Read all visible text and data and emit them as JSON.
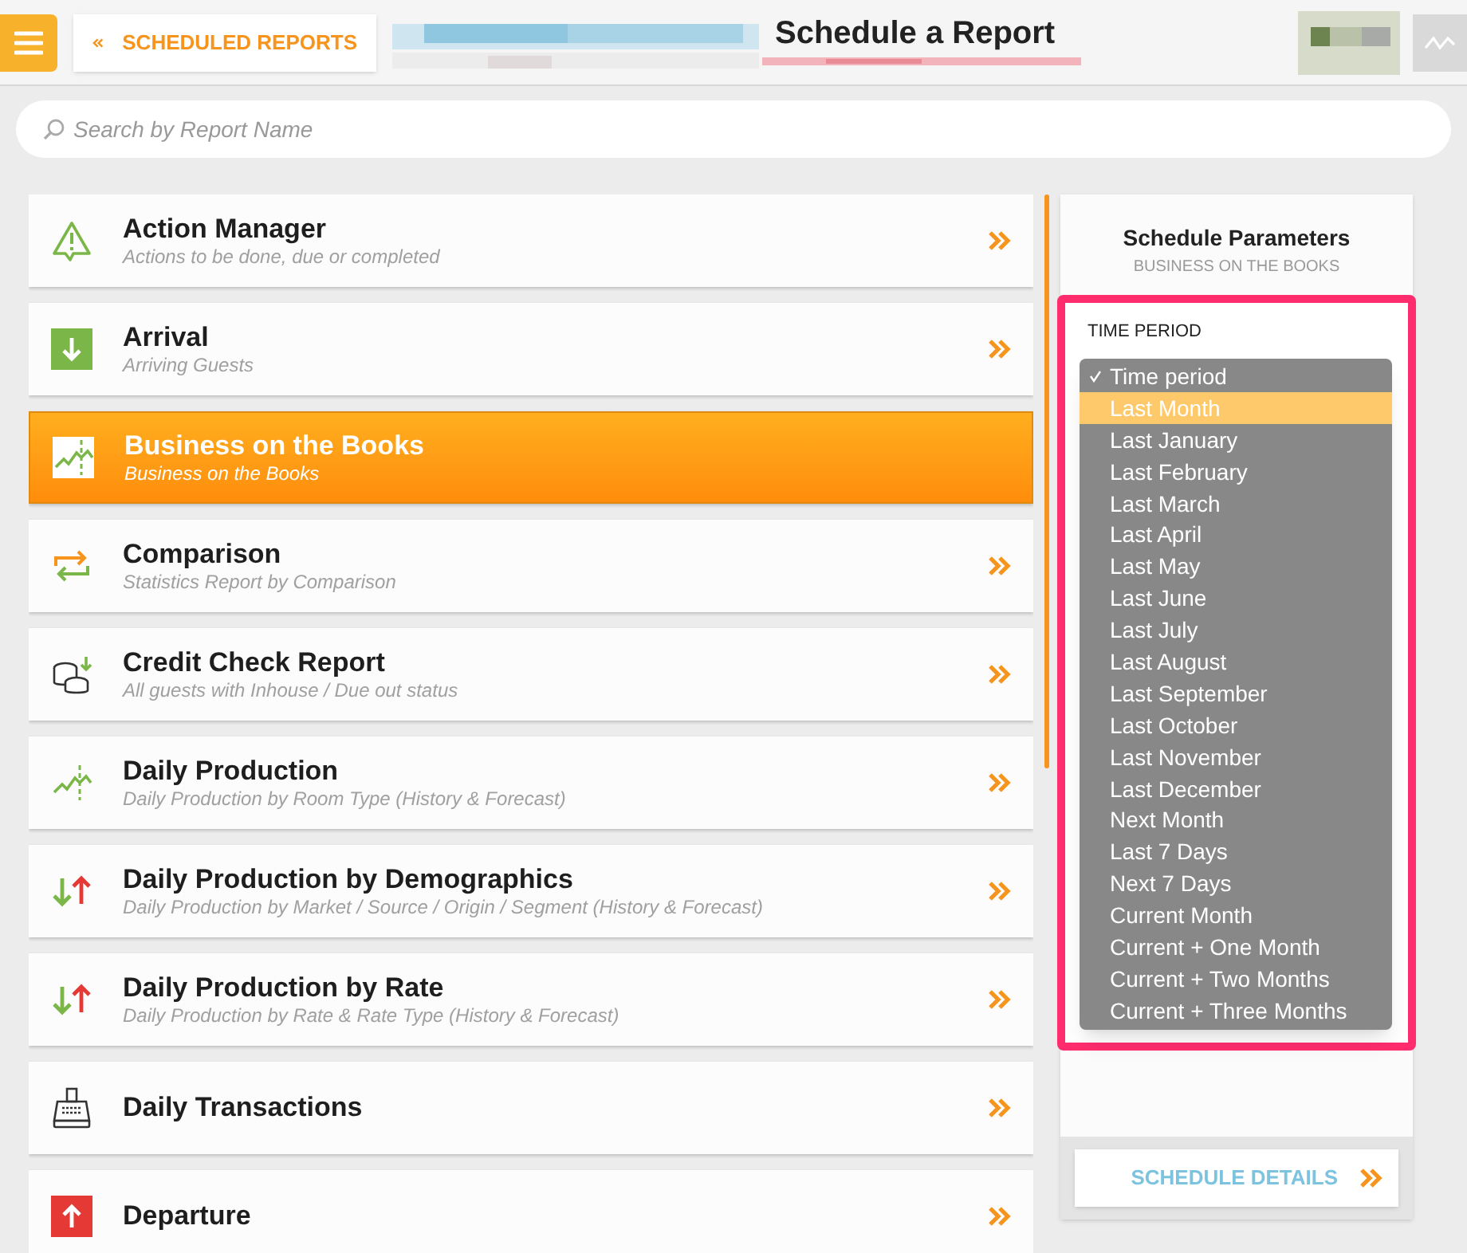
{
  "header": {
    "back_label": "SCHEDULED REPORTS",
    "title": "Schedule a Report"
  },
  "search": {
    "placeholder": "Search by Report Name"
  },
  "reports": [
    {
      "kind": "alert",
      "title": "Action Manager",
      "subtitle": "Actions to be done, due or completed",
      "selected": false
    },
    {
      "kind": "arrival",
      "title": "Arrival",
      "subtitle": "Arriving Guests",
      "selected": false
    },
    {
      "kind": "chart",
      "title": "Business on the Books",
      "subtitle": "Business on the Books",
      "selected": true
    },
    {
      "kind": "compare",
      "title": "Comparison",
      "subtitle": "Statistics Report by Comparison",
      "selected": false
    },
    {
      "kind": "coins",
      "title": "Credit Check Report",
      "subtitle": "All guests with Inhouse / Due out status",
      "selected": false
    },
    {
      "kind": "chart",
      "title": "Daily Production",
      "subtitle": "Daily Production by Room Type (History & Forecast)",
      "selected": false
    },
    {
      "kind": "updown",
      "title": "Daily Production by Demographics",
      "subtitle": "Daily Production by Market / Source / Origin / Segment (History & Forecast)",
      "selected": false
    },
    {
      "kind": "updown",
      "title": "Daily Production by Rate",
      "subtitle": "Daily Production by Rate & Rate Type (History & Forecast)",
      "selected": false
    },
    {
      "kind": "register",
      "title": "Daily Transactions",
      "selected": false
    },
    {
      "kind": "departure",
      "title": "Departure",
      "selected": false
    }
  ],
  "panel": {
    "title": "Schedule Parameters",
    "subtitle": "BUSINESS ON THE BOOKS",
    "field_label": "TIME PERIOD",
    "options": [
      {
        "label": "Time period",
        "checked": true,
        "highlighted": false
      },
      {
        "label": "Last Month",
        "checked": false,
        "highlighted": true
      },
      {
        "label": "Last January",
        "checked": false,
        "highlighted": false
      },
      {
        "label": "Last February",
        "checked": false,
        "highlighted": false
      },
      {
        "label": "Last March",
        "checked": false,
        "highlighted": false
      },
      {
        "label": "Last April",
        "checked": false,
        "highlighted": false
      },
      {
        "label": "Last May",
        "checked": false,
        "highlighted": false
      },
      {
        "label": "Last June",
        "checked": false,
        "highlighted": false
      },
      {
        "label": "Last July",
        "checked": false,
        "highlighted": false
      },
      {
        "label": "Last August",
        "checked": false,
        "highlighted": false
      },
      {
        "label": "Last September",
        "checked": false,
        "highlighted": false
      },
      {
        "label": "Last October",
        "checked": false,
        "highlighted": false
      },
      {
        "label": "Last November",
        "checked": false,
        "highlighted": false
      },
      {
        "label": "Last December",
        "checked": false,
        "highlighted": false
      },
      {
        "label": "Next Month",
        "checked": false,
        "highlighted": false
      },
      {
        "label": "Last 7 Days",
        "checked": false,
        "highlighted": false
      },
      {
        "label": "Next 7 Days",
        "checked": false,
        "highlighted": false
      },
      {
        "label": "Current Month",
        "checked": false,
        "highlighted": false
      },
      {
        "label": "Current + One Month",
        "checked": false,
        "highlighted": false
      },
      {
        "label": "Current + Two Months",
        "checked": false,
        "highlighted": false
      },
      {
        "label": "Current + Three Months",
        "checked": false,
        "highlighted": false
      }
    ],
    "button": "SCHEDULE DETAILS"
  }
}
